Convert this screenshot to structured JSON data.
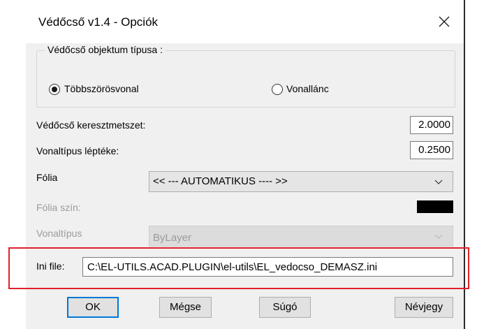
{
  "window": {
    "title": "Védőcső v1.4 - Opciók",
    "close_icon": "close-icon"
  },
  "object_type": {
    "group_title": "Védőcső objektum típusa :",
    "options": [
      {
        "label": "Többszörösvonal",
        "selected": true
      },
      {
        "label": "Vonallánc",
        "selected": false
      }
    ]
  },
  "cross_section": {
    "label": "Védőcső keresztmetszet:",
    "value": "2.0000"
  },
  "linetype_scale": {
    "label": "Vonaltípus léptéke:",
    "value": "0.2500"
  },
  "foil": {
    "label": "Fólia",
    "value": "<< --- AUTOMATIKUS ---- >>"
  },
  "foil_color": {
    "label": "Fólia szín:",
    "color": "#000000"
  },
  "linetype": {
    "label": "Vonaltípus",
    "value": "ByLayer"
  },
  "ini_file": {
    "label": "Ini file:",
    "value": "C:\\EL-UTILS.ACAD.PLUGIN\\el-utils\\EL_vedocso_DEMASZ.ini"
  },
  "buttons": {
    "ok": "OK",
    "cancel": "Mégse",
    "help": "Súgó",
    "about": "Névjegy"
  },
  "colors": {
    "highlight": "#e0202a",
    "focus": "#0078d7"
  }
}
